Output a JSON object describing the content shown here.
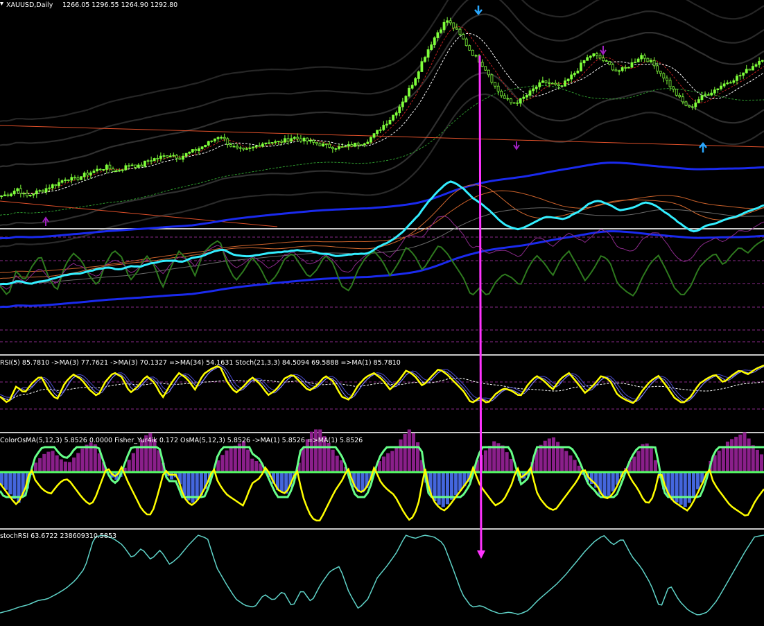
{
  "header": {
    "symbol_label": "XAUUSD,Daily",
    "ohlc": "1266.05 1296.55 1264.90 1292.80"
  },
  "indicators": {
    "rsi_label": "RSI(5) 85.7810 ->MA(3) 77.7621 ->MA(3) 70.1327 =>MA(34) 54.1631 Stoch(21,3,3) 84.5094 69.5888 =>MA(1) 85.7810",
    "osma_label": "ColorOsMA(5,12,3) 5.8526 0.0000 Fisher_Yur4ik 0.172 OsMA(5,12,3) 5.8526 ->MA(1) 5.8526 =>MA(1) 5.8526",
    "stochrsi_label": "stochRSI 63.6722 238609310.5853"
  },
  "colors": {
    "candle": "#7fff3a",
    "rsi_line": "#ffff00",
    "fisher_line": "#66ff88",
    "osma_positive": "#8a1f8a",
    "osma_negative": "#4466dd",
    "stochrsi_line": "#5fd3c8",
    "annotation_arrow": "#ff33ff",
    "signal_up_arrow": "#29a8ff",
    "signal_down_arrow": "#a020c0",
    "trendline": "#e0502a",
    "bands": "#3a3a3a",
    "mid_line_cyan": "#33eeff",
    "blue_band": "#1a2aee",
    "green_line": "#2e7a1e",
    "panel_separator": "#c8c8c8"
  },
  "chart_data": {
    "type": "line",
    "title": "XAUUSD,Daily",
    "last_bar": {
      "open": 1266.05,
      "high": 1296.55,
      "low": 1264.9,
      "close": 1292.8
    },
    "indicator_values": {
      "RSI(5)": 85.781,
      "RSI_MA3": 77.7621,
      "RSI_MA3b": 70.1327,
      "RSI_MA34": 54.1631,
      "Stoch_main": 84.5094,
      "Stoch_signal": 69.5888,
      "ColorOsMA": 5.8526,
      "Fisher_Yur4ik": 0.172,
      "stochRSI": 63.6722
    },
    "price_series": [
      23,
      25,
      30,
      22,
      26,
      28,
      32,
      35,
      40,
      38,
      42,
      45,
      48,
      50,
      46,
      49,
      53,
      50,
      56,
      58,
      60,
      62,
      59,
      63,
      66,
      70,
      75,
      80,
      72,
      67,
      65,
      68,
      72,
      74,
      73,
      75,
      78,
      76,
      74,
      72,
      70,
      69,
      68,
      70,
      72,
      74,
      80,
      88,
      95,
      105,
      118,
      132,
      150,
      165,
      178,
      188,
      180,
      170,
      158,
      150,
      140,
      125,
      115,
      110,
      112,
      118,
      125,
      130,
      128,
      124,
      132,
      140,
      150,
      156,
      152,
      146,
      140,
      142,
      148,
      155,
      150,
      142,
      133,
      122,
      112,
      105,
      113,
      118,
      122,
      127,
      131,
      135,
      140,
      146,
      152
    ],
    "series": [
      {
        "name": "RSI(5)",
        "values": [
          40,
          30,
          55,
          45,
          60,
          70,
          48,
          35,
          60,
          72,
          65,
          50,
          40,
          62,
          75,
          68,
          45,
          55,
          70,
          60,
          38,
          58,
          74,
          66,
          50,
          72,
          80,
          85,
          60,
          45,
          55,
          68,
          58,
          42,
          50,
          66,
          72,
          60,
          48,
          56,
          70,
          62,
          40,
          35,
          55,
          68,
          74,
          65,
          50,
          62,
          78,
          70,
          55,
          68,
          80,
          72,
          60,
          48,
          30,
          38,
          30,
          44,
          52,
          48,
          40,
          58,
          70,
          62,
          50,
          66,
          74,
          60,
          45,
          56,
          70,
          64,
          42,
          35,
          30,
          48,
          62,
          70,
          55,
          38,
          30,
          40,
          58,
          66,
          72,
          60,
          70,
          78,
          72,
          80,
          85
        ]
      },
      {
        "name": "stochRSI",
        "values": [
          5,
          8,
          12,
          15,
          20,
          22,
          28,
          35,
          45,
          60,
          98,
          100,
          96,
          88,
          72,
          84,
          70,
          82,
          64,
          74,
          88,
          100,
          96,
          60,
          40,
          22,
          14,
          12,
          28,
          20,
          32,
          12,
          34,
          18,
          40,
          56,
          62,
          30,
          10,
          22,
          48,
          62,
          78,
          100,
          96,
          100,
          98,
          90,
          60,
          28,
          12,
          14,
          8,
          4,
          6,
          3,
          8,
          20,
          30,
          40,
          52,
          66,
          80,
          92,
          100,
          88,
          96,
          74,
          60,
          40,
          10,
          40,
          20,
          8,
          2,
          6,
          20,
          40,
          60,
          80,
          98,
          100
        ]
      },
      {
        "name": "ColorOsMA",
        "values": [
          -6,
          -10,
          -14,
          -8,
          4,
          8,
          10,
          6,
          4,
          8,
          12,
          14,
          6,
          -2,
          -4,
          4,
          10,
          16,
          18,
          8,
          -4,
          -2,
          -12,
          -14,
          -10,
          -4,
          6,
          10,
          12,
          14,
          6,
          4,
          -2,
          -8,
          -10,
          -4,
          10,
          18,
          20,
          14,
          8,
          4,
          -6,
          -10,
          -6,
          4,
          8,
          10,
          16,
          20,
          12,
          -8,
          -14,
          -16,
          -12,
          -8,
          -4,
          6,
          10,
          14,
          12,
          6,
          -4,
          -2,
          10,
          14,
          16,
          12,
          8,
          4,
          -4,
          -6,
          -12,
          -10,
          -4,
          4,
          8,
          14,
          10,
          -6,
          -12,
          -14,
          -16,
          -10,
          -4,
          6,
          10,
          14,
          16,
          18,
          12,
          8
        ]
      }
    ],
    "price_axis": "hidden",
    "grid": false
  }
}
